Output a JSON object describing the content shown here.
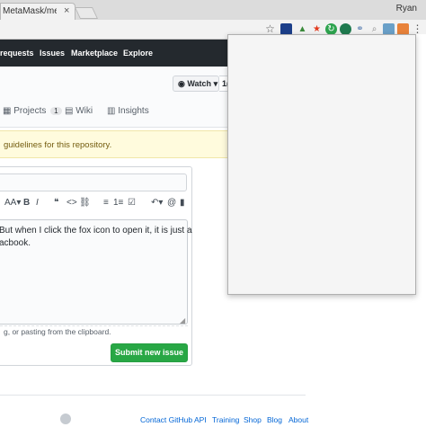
{
  "browser": {
    "tab_title": "MetaMask/metam",
    "tab_close": "×",
    "profile_name": "Ryan",
    "star_icon": "☆",
    "menu_icon": "⋮"
  },
  "header": {
    "nav": [
      "requests",
      "Issues",
      "Marketplace",
      "Explore"
    ]
  },
  "repo": {
    "watch_label": "Watch",
    "watch_count": "1(",
    "tabs": {
      "projects": "Projects",
      "projects_count": "1",
      "wiki": "Wiki",
      "insights": "Insights"
    }
  },
  "flash": {
    "text": "guidelines for this repository."
  },
  "editor": {
    "toolbar": [
      "AA▾",
      "B",
      "I",
      "❝",
      "<>",
      "⛓",
      "≡",
      "1≡",
      "☑",
      "↶▾",
      "@",
      "▮"
    ],
    "body_lines": [
      "But when I click the fox icon to open it, it is just a",
      "acbook."
    ],
    "paste_hint": "g, or pasting from the clipboard.",
    "submit_label": "Submit new issue"
  },
  "footer": {
    "links": [
      "Contact GitHub",
      "API",
      "Training",
      "Shop",
      "Blog",
      "About"
    ]
  },
  "colors": {
    "header_bg": "#24292e",
    "submit_green": "#28a745",
    "flash_bg": "#fffbdd",
    "link_blue": "#0366d6"
  }
}
